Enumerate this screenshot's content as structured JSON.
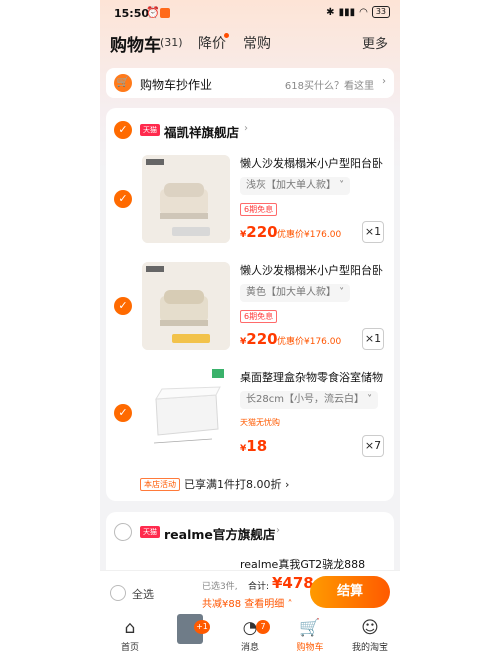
{
  "status_bar": {
    "time": "15:50",
    "battery": "33"
  },
  "header": {
    "title": "购物车",
    "count": "(31)",
    "tab_price": "降价",
    "tab_used": "常购",
    "more": "更多"
  },
  "banner": {
    "label": "购物车抄作业",
    "hint": "618买什么？看这里"
  },
  "store1": {
    "badge": "天猫",
    "name": "福凯祥旗舰店",
    "items": [
      {
        "title": "懒人沙发榻榻米小户型阳台卧",
        "variant": "浅灰【加大单人款】",
        "tag": "6期免息",
        "price_symbol": "¥",
        "price": "220",
        "coupon": "优惠价¥176.00",
        "qty": "×1",
        "thumb_caption": "浅灰色加大款"
      },
      {
        "title": "懒人沙发榻榻米小户型阳台卧",
        "variant": "黄色【加大单人款】",
        "tag": "6期免息",
        "price_symbol": "¥",
        "price": "220",
        "coupon": "优惠价¥176.00",
        "qty": "×1",
        "thumb_caption": "黄色加大款"
      },
      {
        "title": "桌面整理盒杂物零食浴室储物",
        "variant": "长28cm【小号，流云白】",
        "tag": "天猫无忧购",
        "price_symbol": "¥",
        "price": "18",
        "coupon": "",
        "qty": "×7",
        "thumb_caption": ""
      }
    ],
    "promo_tag": "本店活动",
    "promo_text": "已享满1件打8.00折"
  },
  "store2": {
    "badge": "天猫",
    "name": "realme官方旗舰店",
    "peek_title": "realme真我GT2骁龙888"
  },
  "checkout": {
    "all_label": "全选",
    "selected": "已选3件,",
    "total_label": "合计:",
    "total": "¥478",
    "discount": "共减¥88 查看明细",
    "pay_label": "结算"
  },
  "tabbar": {
    "home": "首页",
    "messages": "消息",
    "messages_badge": "7",
    "promo_badge": "+1",
    "cart": "购物车",
    "mine": "我的淘宝"
  }
}
